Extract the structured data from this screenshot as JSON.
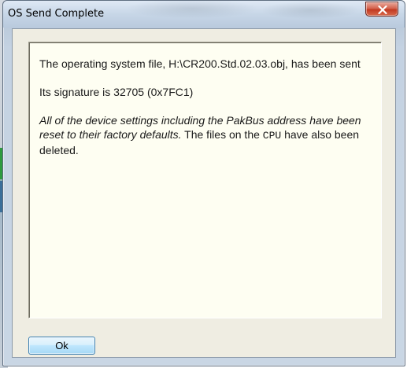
{
  "window": {
    "title": "OS Send Complete",
    "close_icon": "close-x-icon"
  },
  "message": {
    "line1": "The operating system file, H:\\CR200.Std.02.03.obj, has been sent",
    "line2": "Its signature is 32705 (0x7FC1)",
    "line3_italic": "All of the device settings including the PakBus address have been reset to their factory defaults.",
    "line3_normal_a": " The files on the ",
    "line3_mono": "CPU",
    "line3_normal_b": " have also been deleted."
  },
  "buttons": {
    "ok_label": "Ok"
  },
  "colors": {
    "close_button": "#c23a22",
    "message_background": "#fefef2",
    "ok_button_border": "#3c7fb1"
  }
}
